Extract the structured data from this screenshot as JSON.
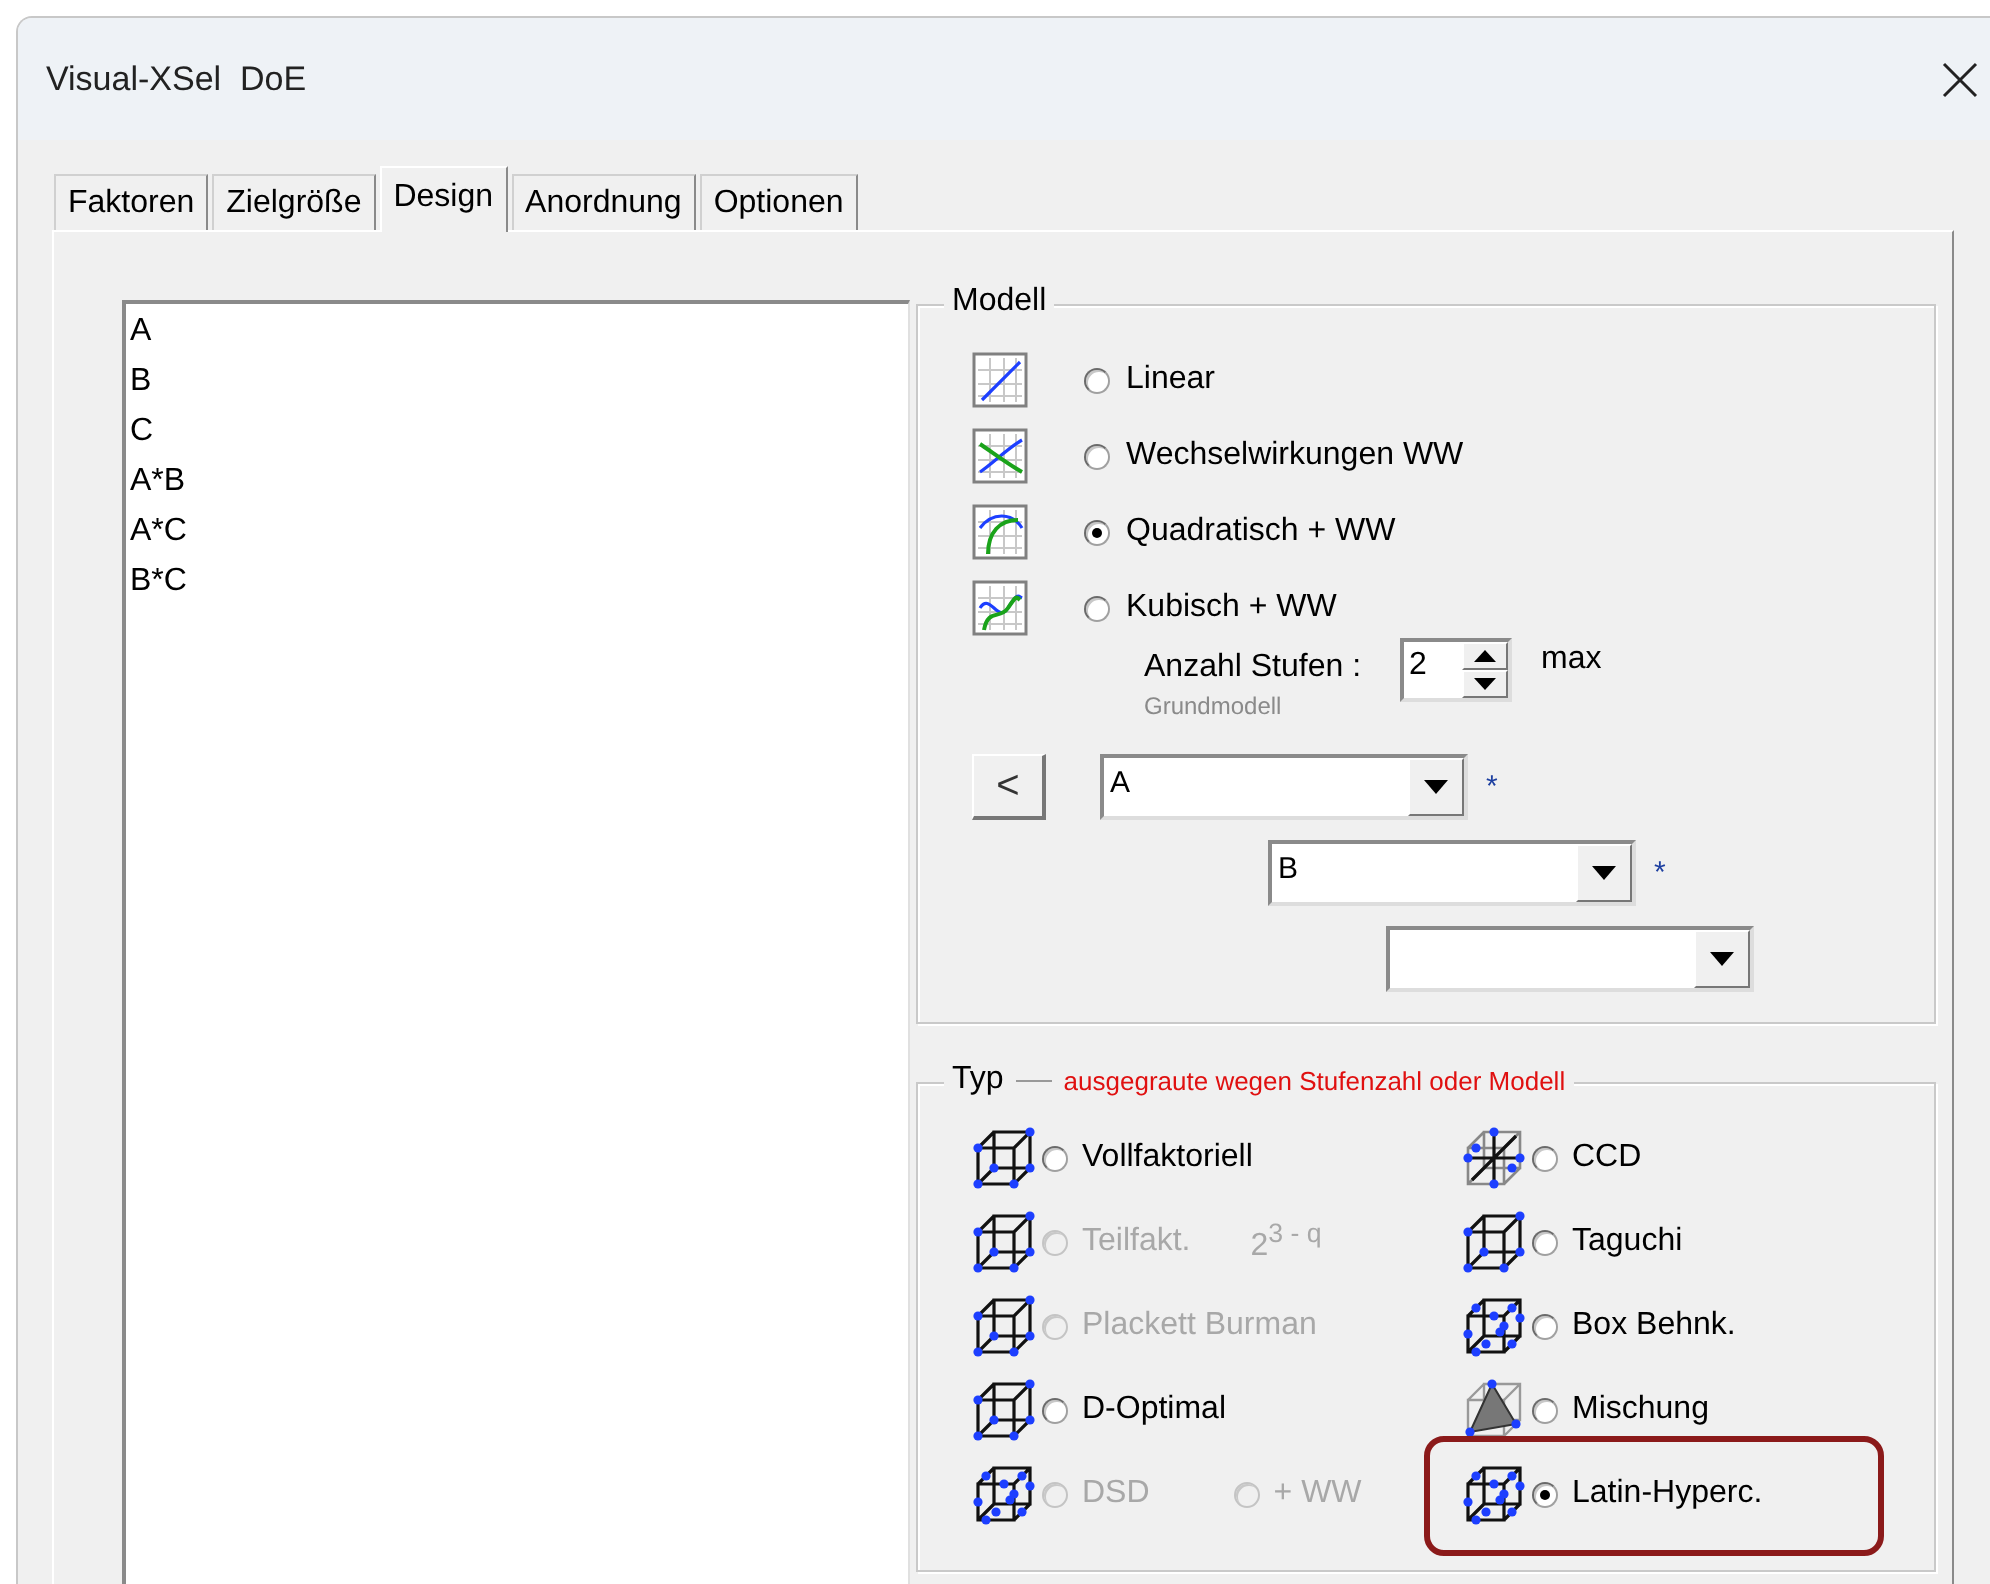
{
  "window": {
    "title": "Visual-XSel  DoE"
  },
  "tabs": [
    {
      "label": "Faktoren",
      "selected": false
    },
    {
      "label": "Zielgröße",
      "selected": false
    },
    {
      "label": "Design",
      "selected": true
    },
    {
      "label": "Anordnung",
      "selected": false
    },
    {
      "label": "Optionen",
      "selected": false
    }
  ],
  "terms": [
    "A",
    "B",
    "C",
    "A*B",
    "A*C",
    "B*C"
  ],
  "model": {
    "title": "Modell",
    "options": [
      {
        "kind": "linear",
        "label": "Linear",
        "selected": false
      },
      {
        "kind": "interaction",
        "label": "Wechselwirkungen WW",
        "selected": false
      },
      {
        "kind": "quadratic",
        "label": "Quadratisch + WW",
        "selected": true
      },
      {
        "kind": "cubic",
        "label": "Kubisch + WW",
        "selected": false
      }
    ],
    "levels": {
      "label": "Anzahl Stufen :",
      "note": "Grundmodell",
      "value": "2",
      "suffix": "max"
    },
    "back_button": "<",
    "factor_selects": [
      {
        "kind": "dropdown",
        "value": "A",
        "operator": "*"
      },
      {
        "kind": "dropdown",
        "value": "B",
        "operator": "*"
      },
      {
        "kind": "dropdown"
      }
    ]
  },
  "type": {
    "title": "Typ",
    "note": "ausgegraute wegen Stufenzahl oder Modell",
    "options": [
      {
        "kind": "cube",
        "label": "Vollfaktoriell",
        "selected": false,
        "disabled": false,
        "highlighted": false
      },
      {
        "kind": "ccd",
        "label": "CCD",
        "selected": false,
        "disabled": false,
        "highlighted": false
      },
      {
        "kind": "cube",
        "label": "Teilfakt.",
        "suffix": "2$^{3 - q}$",
        "selected": false,
        "disabled": true,
        "highlighted": false
      },
      {
        "kind": "cube",
        "label": "Taguchi",
        "selected": false,
        "disabled": false,
        "highlighted": false
      },
      {
        "kind": "cube",
        "label": "Plackett Burman",
        "selected": false,
        "disabled": true,
        "highlighted": false
      },
      {
        "kind": "sphere",
        "label": "Box Behnk.",
        "selected": false,
        "disabled": false,
        "highlighted": false
      },
      {
        "kind": "cube",
        "label": "D-Optimal",
        "selected": false,
        "disabled": false,
        "highlighted": false
      },
      {
        "kind": "mixture",
        "label": "Mischung",
        "selected": false,
        "disabled": false,
        "highlighted": false
      },
      {
        "kind": "sphere",
        "label": "DSD",
        "selected": false,
        "disabled": true,
        "highlighted": false,
        "extra": {
          "label": "+ WW",
          "selected": false,
          "disabled": true
        }
      },
      {
        "kind": "sphere",
        "label": "Latin-Hyperc.",
        "selected": true,
        "disabled": false,
        "highlighted": true
      }
    ]
  }
}
